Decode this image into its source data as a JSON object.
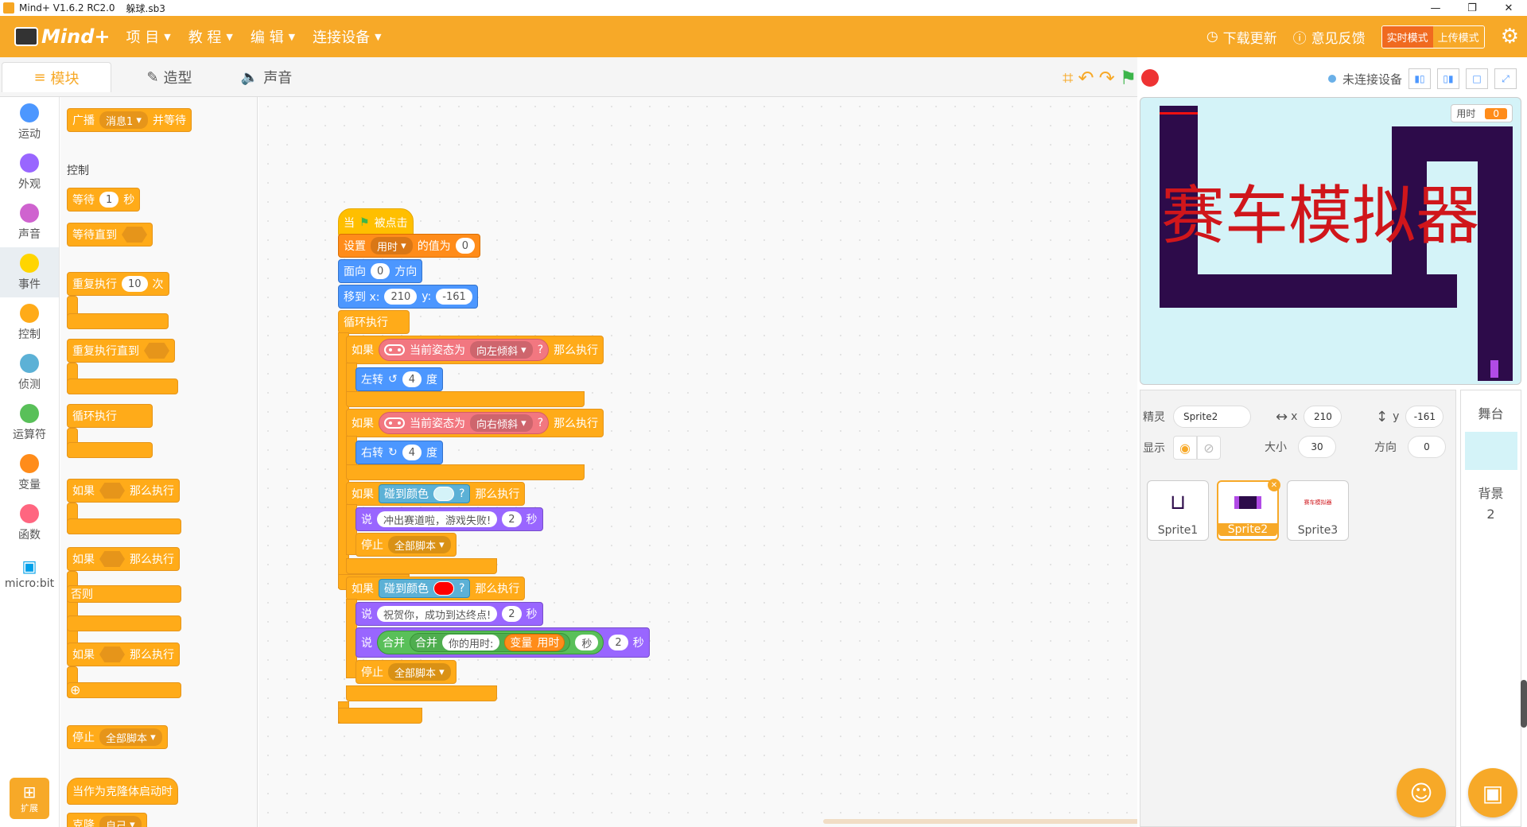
{
  "window": {
    "title": "Mind+ V1.6.2 RC2.0",
    "file": "躲球.sb3",
    "controls": [
      "—",
      "❐",
      "✕"
    ]
  },
  "menubar": {
    "logo": "Mind+",
    "items": [
      "项 目",
      "教 程",
      "编 辑",
      "连接设备"
    ],
    "update": "下载更新",
    "feedback": "意见反馈",
    "mode_realtime": "实时模式",
    "mode_upload": "上传模式"
  },
  "tabs": [
    "模块",
    "造型",
    "声音"
  ],
  "stage_header": {
    "connection": "未连接设备"
  },
  "categories": [
    {
      "label": "运动",
      "color": "#4c97ff"
    },
    {
      "label": "外观",
      "color": "#9966ff"
    },
    {
      "label": "声音",
      "color": "#cf63cf"
    },
    {
      "label": "事件",
      "color": "#ffd500"
    },
    {
      "label": "控制",
      "color": "#ffab19"
    },
    {
      "label": "侦测",
      "color": "#5cb1d6"
    },
    {
      "label": "运算符",
      "color": "#59c059"
    },
    {
      "label": "变量",
      "color": "#ff8c1a"
    },
    {
      "label": "函数",
      "color": "#ff6680"
    },
    {
      "label": "micro:bit",
      "color": "#00a0e9"
    }
  ],
  "extension_label": "扩展",
  "palette": {
    "broadcast": {
      "label": "广播",
      "msg": "消息1",
      "suffix": "并等待"
    },
    "section": "控制",
    "wait": {
      "label": "等待",
      "value": "1",
      "unit": "秒"
    },
    "wait_until": "等待直到",
    "repeat": {
      "label": "重复执行",
      "value": "10",
      "unit": "次"
    },
    "repeat_until": "重复执行直到",
    "forever": "循环执行",
    "if": {
      "label": "如果",
      "then": "那么执行"
    },
    "else": "否则",
    "stop": {
      "label": "停止",
      "option": "全部脚本"
    },
    "clone_start": "当作为克隆体启动时",
    "clone": {
      "label": "克隆",
      "option": "自己"
    }
  },
  "script": {
    "hat": {
      "prefix": "当",
      "suffix": "被点击"
    },
    "set_var": {
      "label": "设置",
      "var": "用时",
      "mid": "的值为",
      "value": "0"
    },
    "point": {
      "label": "面向",
      "value": "0",
      "unit": "方向"
    },
    "goto": {
      "label": "移到 x:",
      "x": "210",
      "ylabel": "y:",
      "y": "-161"
    },
    "forever": "循环执行",
    "if1": {
      "if": "如果",
      "cond": "当前姿态为",
      "dir": "向左倾斜",
      "q": "?",
      "then": "那么执行"
    },
    "turn_left": {
      "label": "左转",
      "value": "4",
      "unit": "度"
    },
    "if2": {
      "if": "如果",
      "cond": "当前姿态为",
      "dir": "向右倾斜",
      "q": "?",
      "then": "那么执行"
    },
    "turn_right": {
      "label": "右转",
      "value": "4",
      "unit": "度"
    },
    "if3": {
      "if": "如果",
      "cond": "碰到颜色",
      "color": "#d4f3f8",
      "q": "?",
      "then": "那么执行"
    },
    "say_fail": {
      "label": "说",
      "text": "冲出赛道啦，游戏失败!",
      "secs": "2",
      "unit": "秒"
    },
    "stop1": {
      "label": "停止",
      "option": "全部脚本"
    },
    "if4": {
      "if": "如果",
      "cond": "碰到颜色",
      "color": "#ff0000",
      "q": "?",
      "then": "那么执行"
    },
    "say_win": {
      "label": "说",
      "text": "祝贺你，成功到达终点!",
      "secs": "2",
      "unit": "秒"
    },
    "say_time": {
      "label": "说",
      "join": "合并",
      "join2": "合并",
      "text": "你的用时:",
      "var_label": "变量",
      "var": "用时",
      "sec_text": "秒",
      "secs": "2",
      "unit": "秒"
    },
    "stop2": {
      "label": "停止",
      "option": "全部脚本"
    }
  },
  "stage": {
    "title_text": "赛车模拟器",
    "timer_label": "用时",
    "timer_value": "0",
    "track_color": "#2d0b4a",
    "bg_color": "#d4f3f8"
  },
  "sprite_info": {
    "sprite_label": "精灵",
    "sprite_name": "Sprite2",
    "x_label": "x",
    "x": "210",
    "y_label": "y",
    "y": "-161",
    "show_label": "显示",
    "size_label": "大小",
    "size": "30",
    "dir_label": "方向",
    "dir": "0"
  },
  "sprites": [
    {
      "name": "Sprite1"
    },
    {
      "name": "Sprite2",
      "selected": true
    },
    {
      "name": "Sprite3",
      "preview": "赛车模拟器"
    }
  ],
  "stage_col": {
    "label": "舞台",
    "backdrop_label": "背景",
    "backdrop_count": "2"
  }
}
